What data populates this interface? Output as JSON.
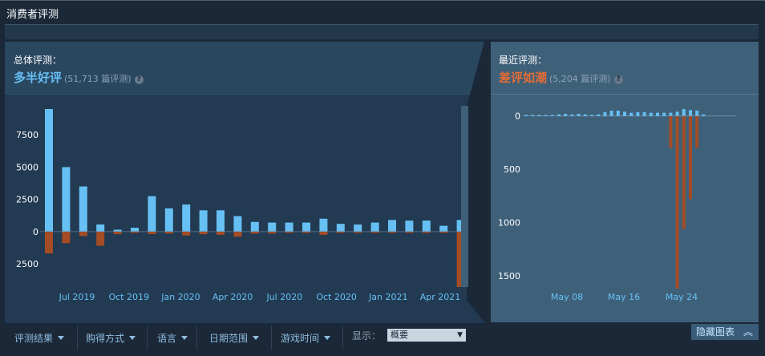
{
  "section_title": "消费者评测",
  "overall": {
    "label": "总体评测：",
    "summary": "多半好评",
    "count": "(51,713 篇评测)",
    "help": "?",
    "summary_color": "#66c0f4"
  },
  "recent": {
    "label": "最近评测：",
    "summary": "差评如潮",
    "count": "(5,204 篇评测)",
    "help": "?",
    "summary_color": "#e46d35"
  },
  "filters": {
    "review_result": "评测结果",
    "purchase_type": "购得方式",
    "language": "语言",
    "date_range": "日期范围",
    "playtime": "游戏时间",
    "display_label": "显示：",
    "display_value": "概要"
  },
  "hide_chart": {
    "label": "隐藏图表",
    "icon": "double-chevron-up-icon"
  },
  "colors": {
    "positive": "#66c0f4",
    "negative": "#a34c25",
    "panel_bg": "#2a4760",
    "recent_bg": "#3f6079"
  },
  "chart_data": [
    {
      "type": "bar",
      "title": "",
      "series": [
        {
          "name": "",
          "values": [
            9500,
            5000,
            3500,
            550,
            150,
            300,
            2750,
            1800,
            2100,
            1650,
            1650,
            1200,
            750,
            700,
            700,
            700,
            1000,
            600,
            550,
            700,
            900,
            850,
            850,
            450,
            900
          ]
        },
        {
          "name": "",
          "values": [
            -1700,
            -900,
            -350,
            -1100,
            -200,
            -100,
            -200,
            -150,
            -300,
            -200,
            -250,
            -400,
            -150,
            -150,
            -100,
            -100,
            -250,
            -100,
            -100,
            -100,
            -100,
            -100,
            -100,
            -100,
            -4300
          ]
        }
      ],
      "tick_labels": [
        "Jul 2019",
        "Oct 2019",
        "Jan 2020",
        "Apr 2020",
        "Jul 2020",
        "Oct 2020",
        "Jan 2021",
        "Apr 2021"
      ],
      "yticks": [
        {
          "value": 7500,
          "label": "7500"
        },
        {
          "value": 5000,
          "label": "5000"
        },
        {
          "value": 2500,
          "label": "2500"
        },
        {
          "value": 0,
          "label": "0"
        },
        {
          "value": -2500,
          "label": "2500"
        }
      ],
      "ylim": [
        -4300,
        9500
      ],
      "grid": false
    },
    {
      "type": "bar",
      "title": "",
      "series": [
        {
          "name": "",
          "values": [
            10,
            10,
            10,
            10,
            10,
            15,
            20,
            15,
            20,
            15,
            10,
            15,
            35,
            50,
            50,
            40,
            30,
            35,
            35,
            30,
            30,
            30,
            30,
            40,
            65,
            55,
            50,
            15
          ]
        },
        {
          "name": "",
          "values": [
            0,
            0,
            0,
            0,
            0,
            0,
            0,
            0,
            0,
            0,
            0,
            0,
            0,
            0,
            0,
            0,
            0,
            0,
            0,
            0,
            0,
            0,
            300,
            1620,
            1060,
            780,
            300,
            0
          ]
        }
      ],
      "tick_labels": [
        "May 08",
        "May 16",
        "May 24"
      ],
      "yticks": [
        {
          "value": 0,
          "label": "0"
        },
        {
          "value": 500,
          "label": "500"
        },
        {
          "value": 1000,
          "label": "1000"
        },
        {
          "value": 1500,
          "label": "1500"
        }
      ],
      "ylim": [
        -65,
        1620
      ],
      "grid": false
    }
  ]
}
